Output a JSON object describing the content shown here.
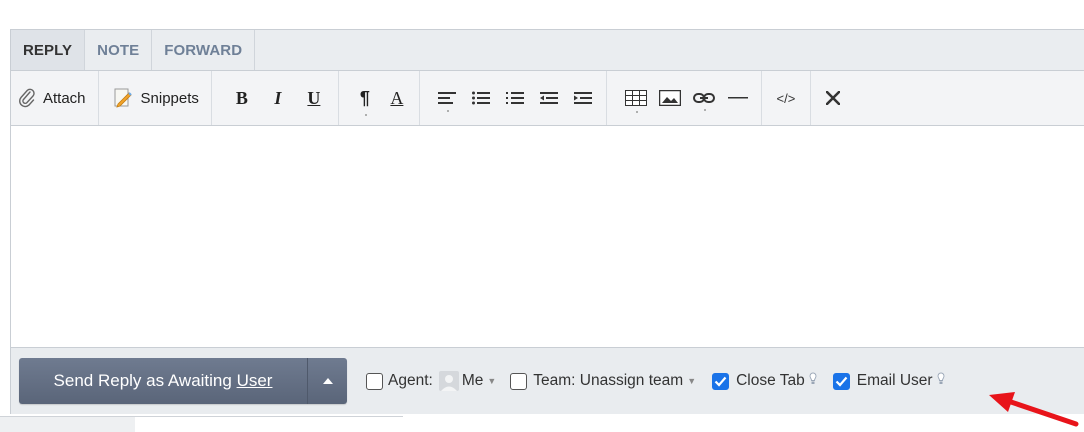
{
  "tabs": [
    {
      "label": "REPLY",
      "active": true
    },
    {
      "label": "NOTE",
      "active": false
    },
    {
      "label": "FORWARD",
      "active": false
    }
  ],
  "toolbar": {
    "attach_label": "Attach",
    "snippets_label": "Snippets",
    "bold_label": "B",
    "italic_label": "I",
    "underline_label": "U",
    "paragraph_label": "¶",
    "font_color_label": "A",
    "code_label": "</>",
    "icons": [
      "paperclip-icon",
      "snippets-icon",
      "bold-icon",
      "italic-icon",
      "underline-icon",
      "paragraph-icon",
      "font-color-icon",
      "align-icon",
      "bulleted-list-icon",
      "numbered-list-icon",
      "outdent-icon",
      "indent-icon",
      "table-icon",
      "image-icon",
      "link-icon",
      "horizontal-rule-icon",
      "code-view-icon",
      "close-icon"
    ]
  },
  "editor": {
    "content": ""
  },
  "footer": {
    "send_label_prefix": "Send Reply as Awaiting ",
    "send_label_underlined": "User",
    "agent_label": "Agent:",
    "agent_value": "Me",
    "agent_checked": false,
    "team_label": "Team: Unassign team",
    "team_checked": false,
    "close_tab_label": "Close Tab",
    "close_tab_checked": true,
    "email_user_label": "Email User",
    "email_user_checked": true
  },
  "colors": {
    "accent_checkbox": "#1a73e8",
    "send_button": "#626d82",
    "annotation_arrow": "#e8141a"
  }
}
